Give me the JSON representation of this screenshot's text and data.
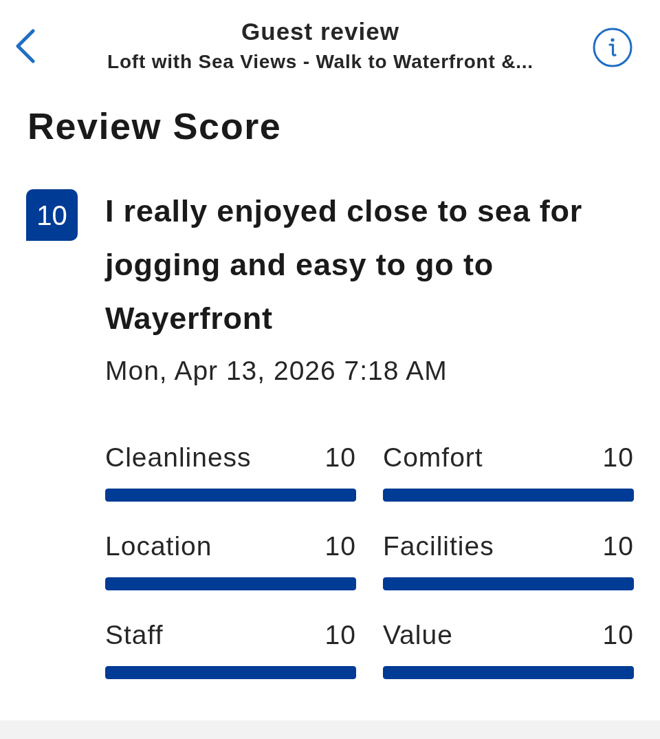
{
  "header": {
    "title": "Guest review",
    "subtitle": "Loft with Sea Views - Walk to Waterfront &..."
  },
  "section_title": "Review Score",
  "review": {
    "score": "10",
    "title": "I really enjoyed close to sea for jogging and easy to go to Wayerfront",
    "date": "Mon, Apr 13, 2026 7:18 AM"
  },
  "categories": [
    {
      "name": "Cleanliness",
      "score": "10",
      "level": 1
    },
    {
      "name": "Comfort",
      "score": "10",
      "level": 1
    },
    {
      "name": "Location",
      "score": "10",
      "level": 1
    },
    {
      "name": "Facilities",
      "score": "10",
      "level": 1
    },
    {
      "name": "Staff",
      "score": "10",
      "level": 1
    },
    {
      "name": "Value",
      "score": "10",
      "level": 1
    }
  ]
}
